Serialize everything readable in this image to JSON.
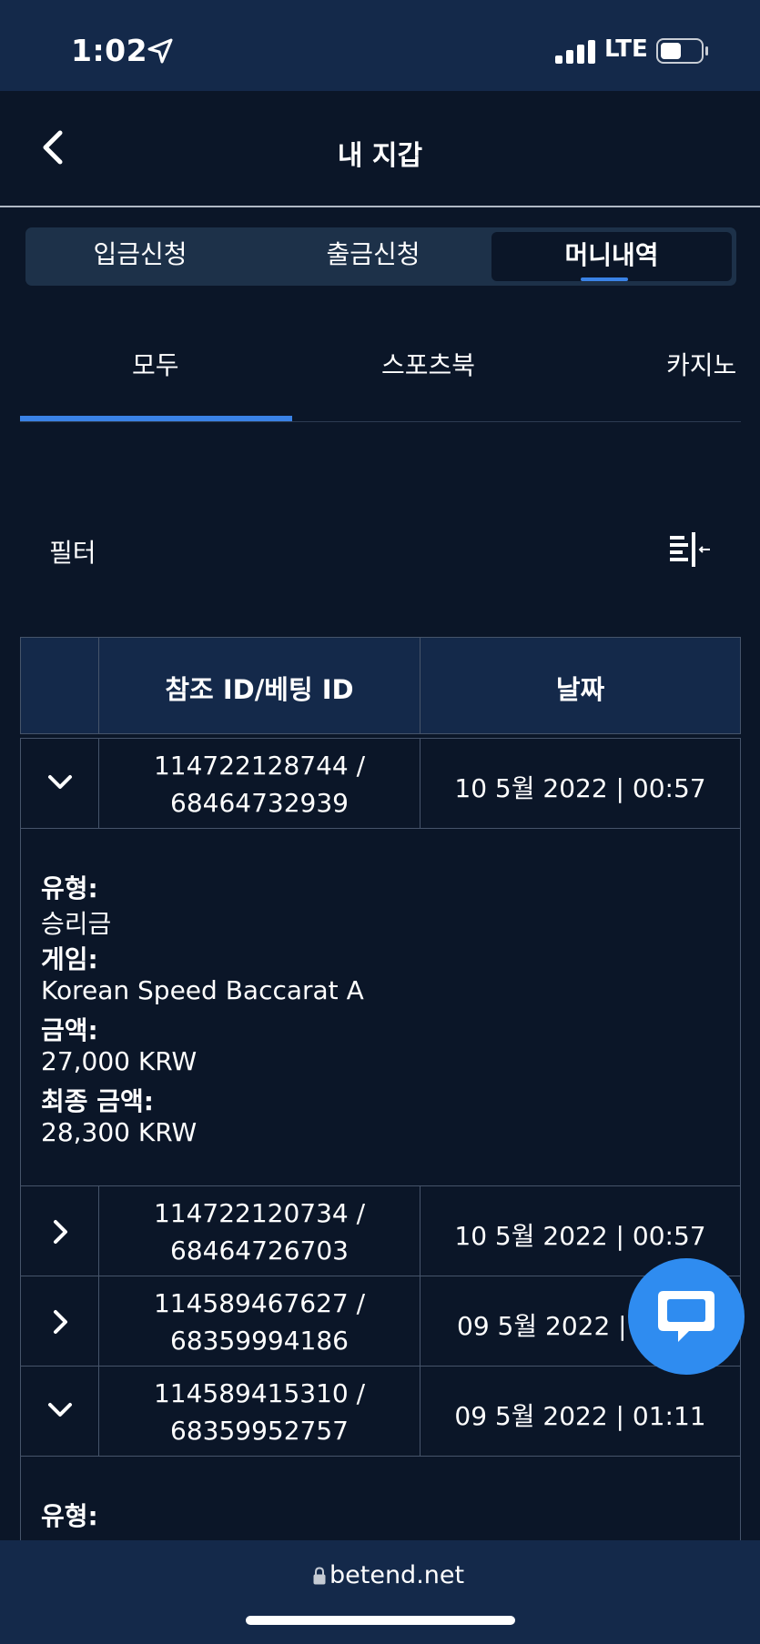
{
  "status_bar": {
    "time": "1:02",
    "network": "LTE"
  },
  "header": {
    "title": "내 지갑"
  },
  "segments": [
    {
      "label": "입금신청"
    },
    {
      "label": "출금신청"
    },
    {
      "label": "머니내역"
    }
  ],
  "category_tabs": [
    {
      "label": "모두"
    },
    {
      "label": "스포츠북"
    },
    {
      "label": "카지노"
    }
  ],
  "filter": {
    "label": "필터"
  },
  "table": {
    "headers": {
      "ref": "참조 ID/베팅 ID",
      "date": "날짜"
    },
    "rows": [
      {
        "ref_line1": "114722128744 /",
        "ref_line2": "68464732939",
        "date": "10 5월 2022 | 00:57",
        "expanded": true,
        "details": {
          "type_label": "유형:",
          "type_value": "승리금",
          "game_label": "게임:",
          "game_value": "Korean Speed Baccarat A",
          "amount_label": "금액:",
          "amount_value": "27,000 KRW",
          "final_label": "최종 금액:",
          "final_value": "28,300 KRW"
        }
      },
      {
        "ref_line1": "114722120734 /",
        "ref_line2": "68464726703",
        "date": "10 5월 2022 | 00:57",
        "expanded": false
      },
      {
        "ref_line1": "114589467627 /",
        "ref_line2": "68359994186",
        "date": "09 5월 2022 | ",
        "expanded": false
      },
      {
        "ref_line1": "114589415310 /",
        "ref_line2": "68359952757",
        "date": "09 5월 2022 | 01:11",
        "expanded": true,
        "details": {
          "type_label": "유형:"
        }
      }
    ]
  },
  "browser": {
    "url": "betend.net"
  },
  "colors": {
    "background": "#0b1628",
    "bar": "#14294a",
    "accent": "#3a82e6",
    "chat": "#2f8cf0",
    "border": "#46546a"
  },
  "icons": [
    "back-chevron-icon",
    "location-arrow-icon",
    "signal-icon",
    "battery-icon",
    "filter-icon",
    "chevron-down-icon",
    "chevron-right-icon",
    "chat-icon",
    "lock-icon"
  ]
}
